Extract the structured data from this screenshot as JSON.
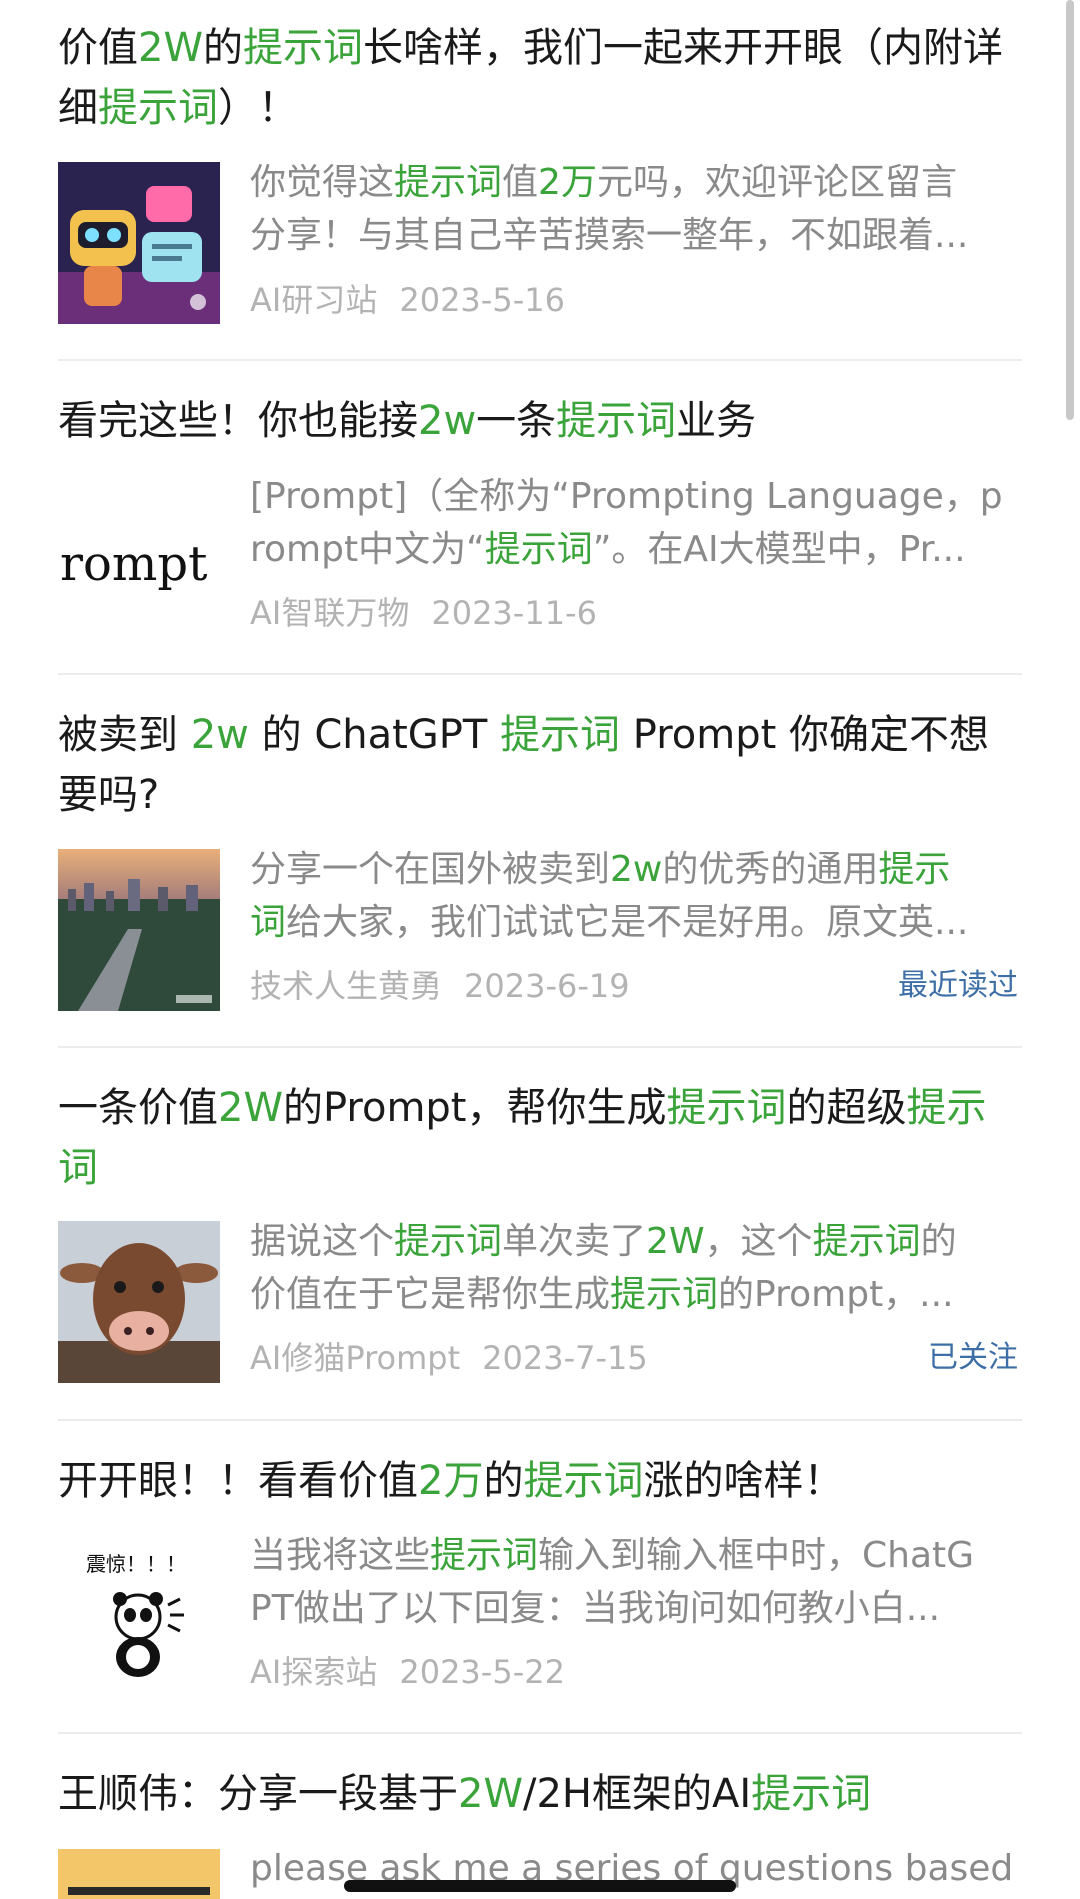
{
  "articles": [
    {
      "title_segments": [
        {
          "t": "价值",
          "h": false
        },
        {
          "t": "2W",
          "h": true
        },
        {
          "t": "的",
          "h": false
        },
        {
          "t": "提示词",
          "h": true
        },
        {
          "t": "长啥样，我们一起来开开眼（内附详细",
          "h": false
        },
        {
          "t": "提示词",
          "h": true
        },
        {
          "t": "）！",
          "h": false
        }
      ],
      "snippet_lines": [
        [
          {
            "t": "你觉得这",
            "h": false
          },
          {
            "t": "提示词",
            "h": true
          },
          {
            "t": "值",
            "h": false
          },
          {
            "t": "2万",
            "h": true
          },
          {
            "t": "元吗，欢迎评论区留言",
            "h": false
          }
        ],
        [
          {
            "t": "分享！与其自己辛苦摸索一整年，不如跟着...",
            "h": false
          }
        ]
      ],
      "source": "AI研习站",
      "date": "2023-5-16",
      "status": "",
      "thumb": "robot-illustration"
    },
    {
      "title_segments": [
        {
          "t": "看完这些！你也能接",
          "h": false
        },
        {
          "t": "2w",
          "h": true
        },
        {
          "t": "一条",
          "h": false
        },
        {
          "t": "提示词",
          "h": true
        },
        {
          "t": "业务",
          "h": false
        }
      ],
      "snippet_lines": [
        [
          {
            "t": "[Prompt]（全称为“Prompting Language，p",
            "h": false
          }
        ],
        [
          {
            "t": "rompt中文为“",
            "h": false
          },
          {
            "t": "提示词",
            "h": true
          },
          {
            "t": "”。在AI大模型中，Pr...",
            "h": false
          }
        ]
      ],
      "source": "AI智联万物",
      "date": "2023-11-6",
      "status": "",
      "thumb": "prompt-text",
      "thumb_text": "rompt"
    },
    {
      "title_segments": [
        {
          "t": "被卖到 ",
          "h": false
        },
        {
          "t": "2w",
          "h": true
        },
        {
          "t": " 的 ChatGPT ",
          "h": false
        },
        {
          "t": "提示词",
          "h": true
        },
        {
          "t": " Prompt 你确定不想要吗?",
          "h": false
        }
      ],
      "snippet_lines": [
        [
          {
            "t": "分享一个在国外被卖到",
            "h": false
          },
          {
            "t": "2w",
            "h": true
          },
          {
            "t": "的优秀的通用",
            "h": false
          },
          {
            "t": "提示",
            "h": true
          }
        ],
        [
          {
            "t": "词",
            "h": true
          },
          {
            "t": "给大家，我们试试它是不是好用。原文英...",
            "h": false
          }
        ]
      ],
      "source": "技术人生黄勇",
      "date": "2023-6-19",
      "status": "最近读过",
      "thumb": "city-highway-photo"
    },
    {
      "title_segments": [
        {
          "t": "一条价值",
          "h": false
        },
        {
          "t": "2W",
          "h": true
        },
        {
          "t": "的Prompt，帮你生成",
          "h": false
        },
        {
          "t": "提示词",
          "h": true
        },
        {
          "t": "的超级",
          "h": false
        },
        {
          "t": "提示词",
          "h": true
        }
      ],
      "snippet_lines": [
        [
          {
            "t": "据说这个",
            "h": false
          },
          {
            "t": "提示词",
            "h": true
          },
          {
            "t": "单次卖了",
            "h": false
          },
          {
            "t": "2W",
            "h": true
          },
          {
            "t": "，这个",
            "h": false
          },
          {
            "t": "提示词",
            "h": true
          },
          {
            "t": "的",
            "h": false
          }
        ],
        [
          {
            "t": "价值在于它是帮你生成",
            "h": false
          },
          {
            "t": "提示词",
            "h": true
          },
          {
            "t": "的Prompt，...",
            "h": false
          }
        ]
      ],
      "source": "AI修猫Prompt",
      "date": "2023-7-15",
      "status": "已关注",
      "thumb": "cow-portrait"
    },
    {
      "title_segments": [
        {
          "t": "开开眼！！看看价值",
          "h": false
        },
        {
          "t": "2万",
          "h": true
        },
        {
          "t": "的",
          "h": false
        },
        {
          "t": "提示词",
          "h": true
        },
        {
          "t": "涨的啥样！",
          "h": false
        }
      ],
      "snippet_lines": [
        [
          {
            "t": "当我将这些",
            "h": false
          },
          {
            "t": "提示词",
            "h": true
          },
          {
            "t": "输入到输入框中时，ChatG",
            "h": false
          }
        ],
        [
          {
            "t": "PT做出了以下回复：当我询问如何教小白...",
            "h": false
          }
        ]
      ],
      "source": "AI探索站",
      "date": "2023-5-22",
      "status": "",
      "thumb": "panda-meme",
      "thumb_text": "震惊！！！"
    },
    {
      "title_segments": [
        {
          "t": "王顺伟：分享一段基于",
          "h": false
        },
        {
          "t": "2W",
          "h": true
        },
        {
          "t": "/2H框架的AI",
          "h": false
        },
        {
          "t": "提示词",
          "h": true
        }
      ],
      "snippet_lines": [
        [
          {
            "t": "please ask me a series of questions based o",
            "h": false
          }
        ]
      ],
      "source": "",
      "date": "",
      "status": "",
      "thumb": "yellow-card"
    }
  ],
  "colors": {
    "highlight": "#3aa33a",
    "title": "#1a1a1a",
    "snippet": "#8a8a8a",
    "meta": "#b3b3b3",
    "status": "#3d6fa6"
  }
}
